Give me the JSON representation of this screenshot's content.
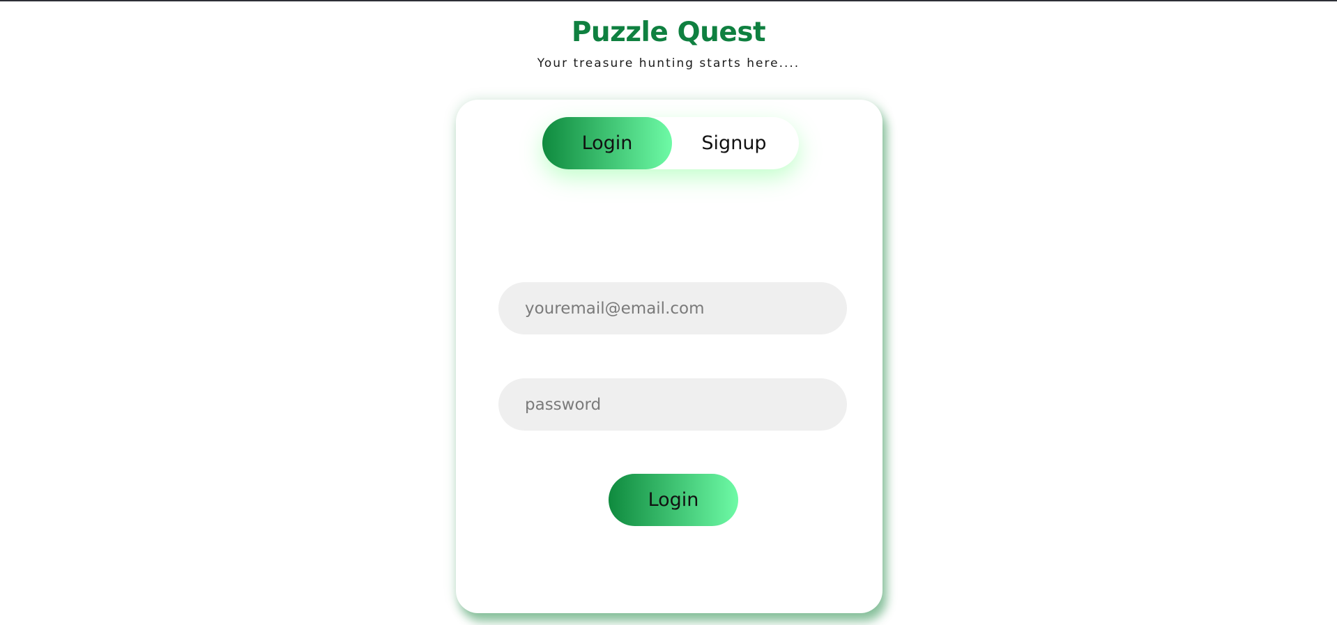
{
  "app": {
    "title": "Puzzle Quest",
    "subtitle": "Your treasure hunting starts here...."
  },
  "tabs": {
    "login_label": "Login",
    "signup_label": "Signup",
    "active": "Login"
  },
  "form": {
    "email_placeholder": "youremail@email.com",
    "email_value": "",
    "password_placeholder": "password",
    "password_value": "",
    "submit_label": "Login"
  },
  "colors": {
    "brand": "#0f8040",
    "gradient_start": "#0f8a3e",
    "gradient_end": "#6efaa6",
    "field_background": "#efefef"
  }
}
